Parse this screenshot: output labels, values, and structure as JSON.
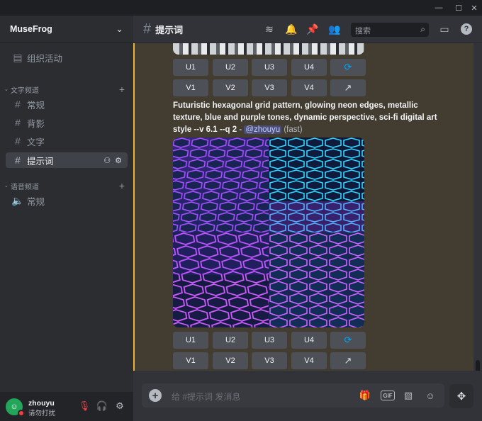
{
  "window": {
    "min": "—",
    "max": "☐",
    "close": "✕"
  },
  "server": {
    "name": "MuseFrog"
  },
  "sidebar": {
    "events_label": "组织活动",
    "text_category": "文字频道",
    "voice_category": "语音频道",
    "text_channels": [
      "常规",
      "背影",
      "文字",
      "提示词"
    ],
    "voice_channels": [
      "常规"
    ],
    "active_channel": "提示词"
  },
  "header": {
    "channel": "提示词",
    "search_placeholder": "搜索"
  },
  "message": {
    "prompt": "Futuristic hexagonal grid pattern, glowing neon edges, metallic texture, blue and purple tones, dynamic perspective, sci-fi digital art style --v 6.1 --q 2",
    "separator": " - ",
    "mention": "@zhouyu",
    "mode": "(fast)"
  },
  "buttons": {
    "upscale": [
      "U1",
      "U2",
      "U3",
      "U4"
    ],
    "variation": [
      "V1",
      "V2",
      "V3",
      "V4"
    ]
  },
  "composer": {
    "placeholder": "给 #提示词 发消息",
    "gif": "GIF"
  },
  "user": {
    "name": "zhouyu",
    "status": "请勿打扰"
  },
  "colors": {
    "accent": "#f0b232",
    "link": "#00a8fc",
    "dnd": "#f23f43",
    "online": "#23a55a"
  }
}
